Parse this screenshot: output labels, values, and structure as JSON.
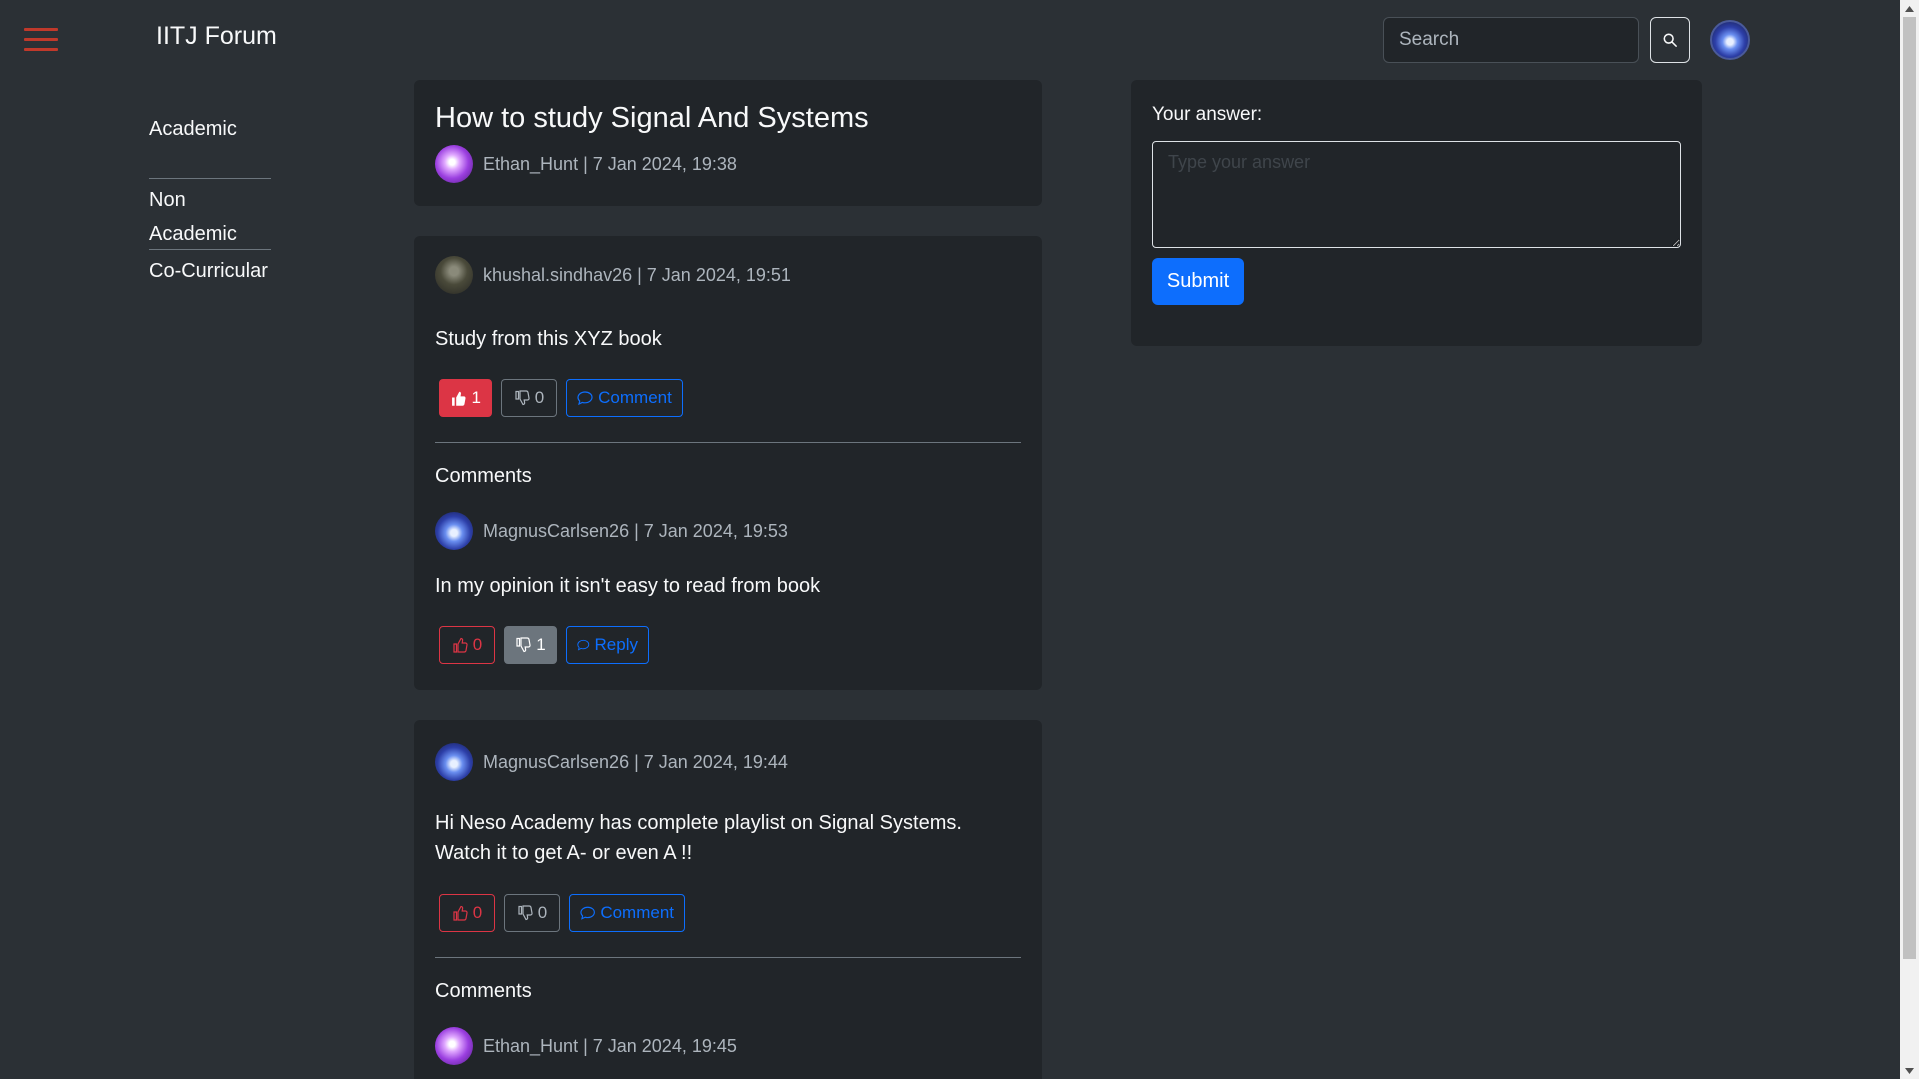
{
  "header": {
    "brand": "IITJ Forum",
    "search_placeholder": "Search",
    "menu_icon": "hamburger-menu-icon",
    "search_icon": "search-icon"
  },
  "sidebar": {
    "items": [
      {
        "label": "Academic"
      },
      {
        "label": "Non Academic"
      },
      {
        "label": "Co-Curricular"
      }
    ]
  },
  "question": {
    "title": "How to study Signal And Systems",
    "meta": "Ethan_Hunt | 7 Jan 2024, 19:38"
  },
  "answers": [
    {
      "meta": "khushal.sindhav26 | 7 Jan 2024, 19:51",
      "text": "Study from this XYZ book",
      "likes": "1",
      "dislikes": "0",
      "comment_label": "Comment",
      "comments_heading": "Comments",
      "comments": [
        {
          "meta": "MagnusCarlsen26 | 7 Jan 2024, 19:53",
          "text": "In my opinion it isn't easy to read from book",
          "likes": "0",
          "dislikes": "1",
          "reply_label": "Reply"
        }
      ]
    },
    {
      "meta": "MagnusCarlsen26 | 7 Jan 2024, 19:44",
      "text": "Hi Neso Academy has complete playlist on Signal Systems. Watch it to get A- or even A !!",
      "likes": "0",
      "dislikes": "0",
      "comment_label": "Comment",
      "comments_heading": "Comments",
      "comments": [
        {
          "meta": "Ethan_Hunt | 7 Jan 2024, 19:45"
        }
      ]
    }
  ],
  "answer_form": {
    "label": "Your answer:",
    "placeholder": "Type your answer",
    "submit_label": "Submit"
  },
  "colors": {
    "background": "#2b3035",
    "card": "#212529",
    "like": "#dc3545",
    "primary": "#0d6efd",
    "secondary": "#6c757d"
  }
}
